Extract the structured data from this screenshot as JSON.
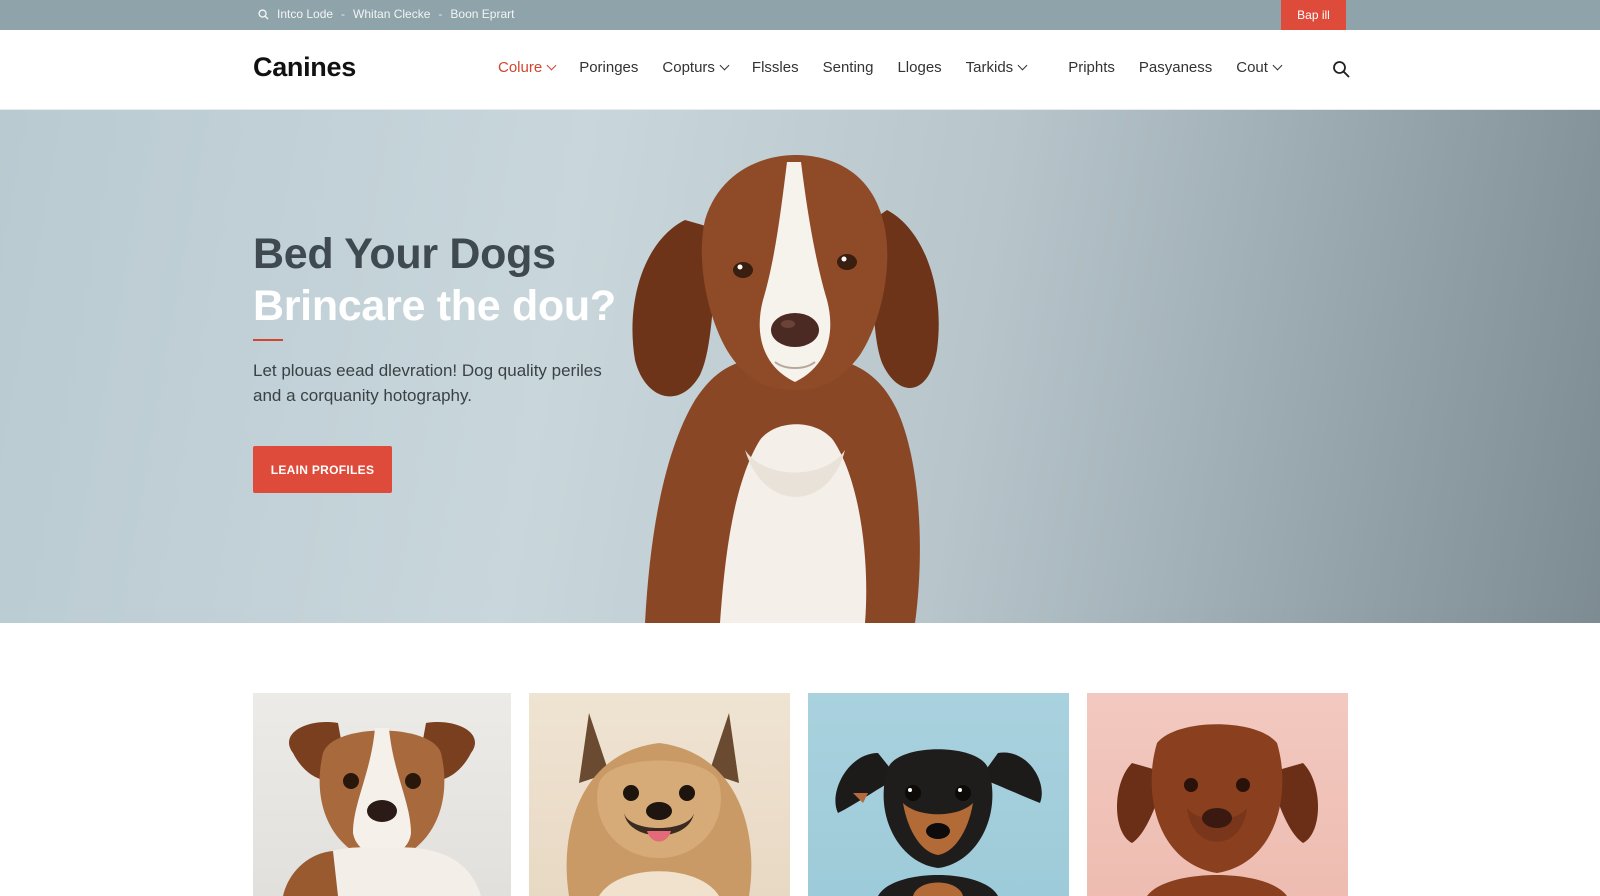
{
  "topbar": {
    "links": [
      "Intco Lode",
      "Whitan Clecke",
      "Boon Eprart"
    ],
    "separator": "-",
    "cta_label": "Bap ill"
  },
  "header": {
    "logo": "Canines",
    "nav": [
      {
        "label": "Colure",
        "dropdown": true,
        "active": true
      },
      {
        "label": "Poringes",
        "dropdown": false
      },
      {
        "label": "Copturs",
        "dropdown": true
      },
      {
        "label": "Flssles",
        "dropdown": false
      },
      {
        "label": "Senting",
        "dropdown": false
      },
      {
        "label": "Lloges",
        "dropdown": false
      },
      {
        "label": "Tarkids",
        "dropdown": true
      },
      {
        "label": "Priphts",
        "dropdown": false
      },
      {
        "label": "Pasyaness",
        "dropdown": false
      },
      {
        "label": "Cout",
        "dropdown": true
      }
    ],
    "search_icon": "search-icon"
  },
  "hero": {
    "title_line1": "Bed Your Dogs",
    "title_line2": "Brincare the dou?",
    "subtitle": "Let plouas eead dlevration! Dog quality periles and a corquanity hotography.",
    "button_label": "LEAIN PROFILES"
  },
  "cards": [
    {
      "icon": "dog-photo-terrier"
    },
    {
      "icon": "dog-photo-spitz"
    },
    {
      "icon": "dog-photo-pinscher"
    },
    {
      "icon": "dog-photo-labrador"
    }
  ],
  "colors": {
    "accent": "#de4b3a",
    "topbar": "#8fa3aa",
    "hero_title_dark": "#3f4a50"
  }
}
